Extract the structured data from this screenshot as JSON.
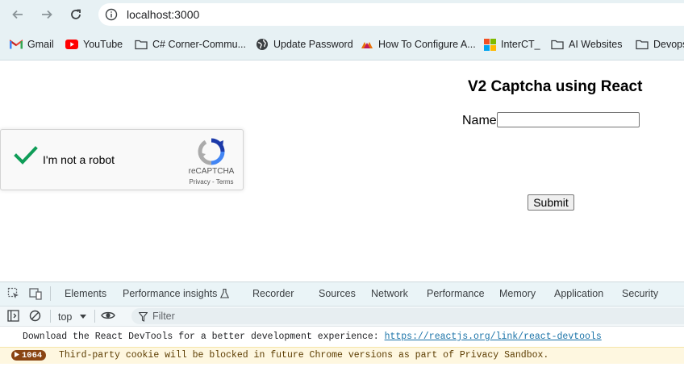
{
  "browser": {
    "url": "localhost:3000",
    "nav_icons": [
      "back-arrow-icon",
      "forward-arrow-icon",
      "reload-icon",
      "site-info-icon"
    ]
  },
  "bookmarks": [
    {
      "label": "Gmail",
      "icon": "gmail-icon"
    },
    {
      "label": "YouTube",
      "icon": "youtube-icon"
    },
    {
      "label": "C# Corner-Commu...",
      "icon": "folder-icon"
    },
    {
      "label": "Update Password",
      "icon": "globe-icon"
    },
    {
      "label": "How To Configure A...",
      "icon": "site-icon"
    },
    {
      "label": "InterCT_",
      "icon": "windows-icon"
    },
    {
      "label": "AI Websites",
      "icon": "folder-icon"
    },
    {
      "label": "Devops",
      "icon": "folder-icon"
    }
  ],
  "page": {
    "title": "V2 Captcha using React",
    "name_label": "Name",
    "name_value": "",
    "submit_label": "Submit"
  },
  "recaptcha": {
    "label": "I'm not a robot",
    "brand": "reCAPTCHA",
    "links": "Privacy - Terms",
    "checked": true,
    "check_color": "#0f9d58"
  },
  "devtools": {
    "tabs": [
      "Elements",
      "Performance insights",
      "Recorder",
      "Sources",
      "Network",
      "Performance",
      "Memory",
      "Application",
      "Security"
    ],
    "context": "top",
    "filter_placeholder": "Filter",
    "messages": {
      "info_text": "Download the React DevTools for a better development experience: ",
      "info_link": "https://reactjs.org/link/react-devtools",
      "warn_count": "1064",
      "warn_text": "Third-party cookie will be blocked in future Chrome versions as part of Privacy Sandbox."
    }
  }
}
